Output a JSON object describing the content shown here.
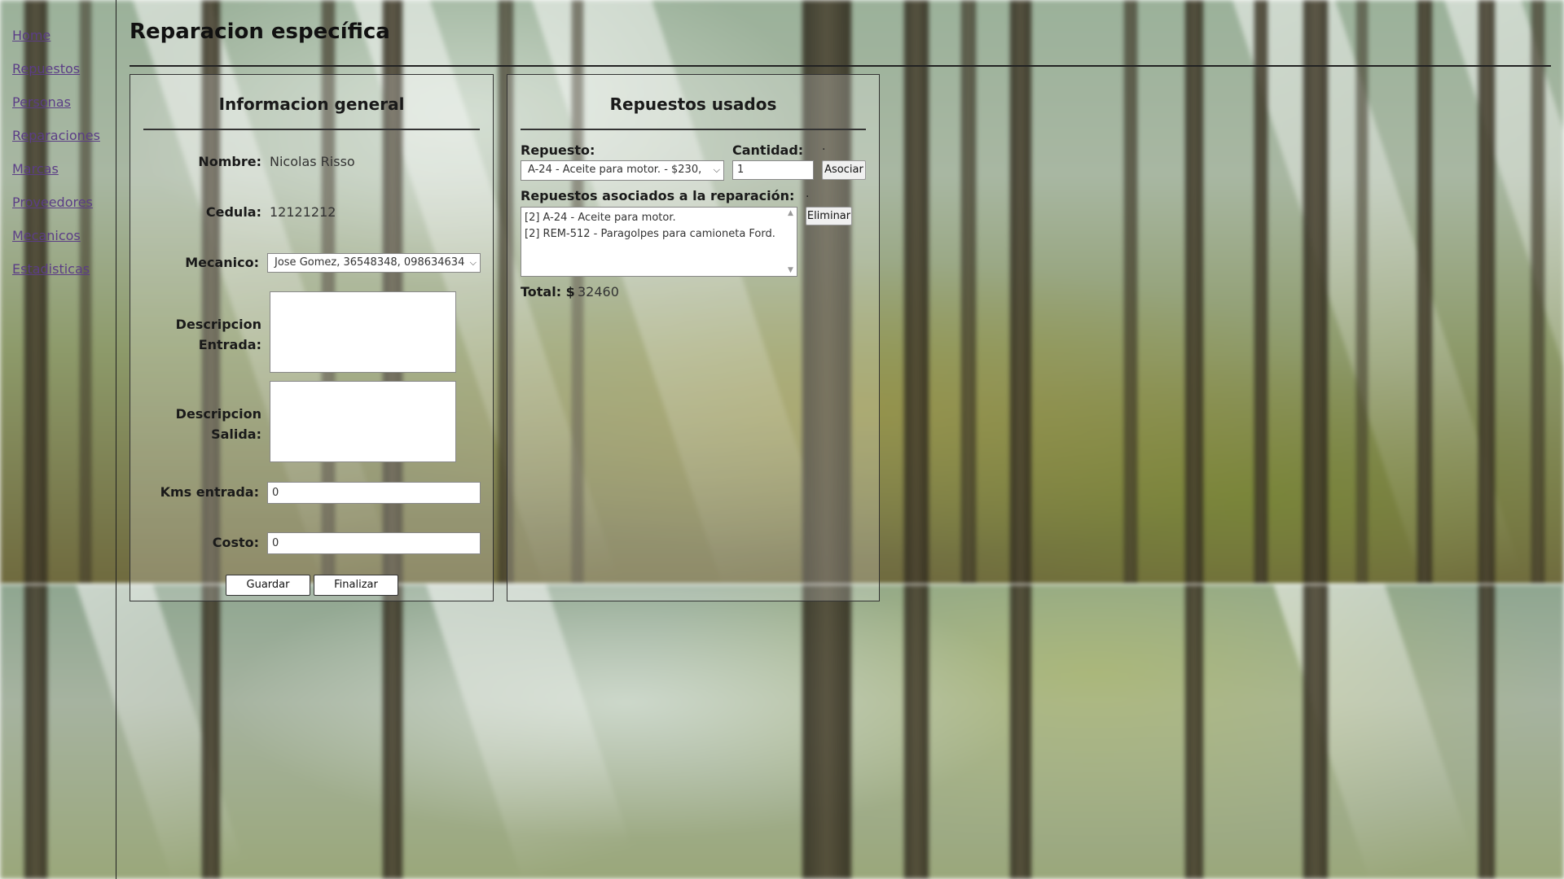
{
  "nav": {
    "items": [
      {
        "label": "Home"
      },
      {
        "label": "Repuestos"
      },
      {
        "label": "Personas"
      },
      {
        "label": "Reparaciones"
      },
      {
        "label": "Marcas"
      },
      {
        "label": "Proveedores"
      },
      {
        "label": "Mecanicos"
      },
      {
        "label": "Estadisticas"
      }
    ]
  },
  "page": {
    "title": "Reparacion específica"
  },
  "general": {
    "heading": "Informacion general",
    "nombre_label": "Nombre:",
    "nombre_value": "Nicolas Risso",
    "cedula_label": "Cedula:",
    "cedula_value": "12121212",
    "mecanico_label": "Mecanico:",
    "mecanico_value": "Jose Gomez, 36548348, 098634634",
    "desc_entrada_label_1": "Descripcion",
    "desc_entrada_label_2": "Entrada:",
    "desc_entrada_value": "",
    "desc_salida_label_1": "Descripcion",
    "desc_salida_label_2": "Salida:",
    "desc_salida_value": "",
    "kms_label": "Kms entrada:",
    "kms_value": "0",
    "costo_label": "Costo:",
    "costo_value": "0",
    "guardar_label": "Guardar",
    "finalizar_label": "Finalizar"
  },
  "repuestos": {
    "heading": "Repuestos usados",
    "repuesto_label": "Repuesto:",
    "repuesto_value": "A-24 - Aceite para motor. - $230,",
    "cantidad_label": "Cantidad:",
    "cantidad_value": "1",
    "dot_1": ".",
    "asociar_label": "Asociar",
    "asociados_label": "Repuestos asociados a la reparación:",
    "dot_2": ".",
    "eliminar_label": "Eliminar",
    "asociados_items": [
      "[2] A-24 - Aceite para motor.",
      "[2] REM-512 - Paragolpes para camioneta Ford."
    ],
    "total_label": "Total: $",
    "total_value": "32460"
  },
  "icons": {
    "select_chevron": "chevron-down-icon",
    "scroll_up": "scroll-up-icon",
    "scroll_down": "scroll-down-icon"
  }
}
